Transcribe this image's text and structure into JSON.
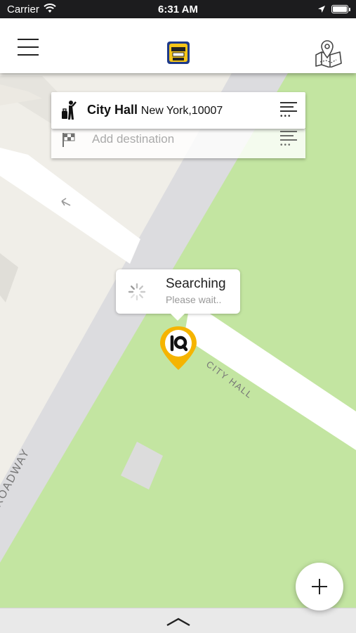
{
  "status_bar": {
    "carrier": "Carrier",
    "time": "6:31 AM"
  },
  "header": {
    "menu_icon": "hamburger-menu-icon",
    "logo_icon": "taxi-app-logo",
    "map_icon": "map-pin-icon"
  },
  "pickup": {
    "name": "City Hall",
    "address": "New York,10007"
  },
  "destination": {
    "placeholder": "Add destination"
  },
  "search_popup": {
    "title": "Searching",
    "subtitle": "Please wait.."
  },
  "marker": {
    "icon": "iq-location-marker",
    "color": "#f5b400"
  },
  "map": {
    "road_labels": [
      "CITY HALL",
      "ROADWAY"
    ],
    "colors": {
      "park": "#c3e5a1",
      "land": "#f0eee8",
      "road_main": "#dcdcdf",
      "road_minor": "#ffffff"
    }
  },
  "fab": {
    "icon": "plus-icon"
  },
  "bottom_bar": {
    "icon": "chevron-up-icon"
  }
}
